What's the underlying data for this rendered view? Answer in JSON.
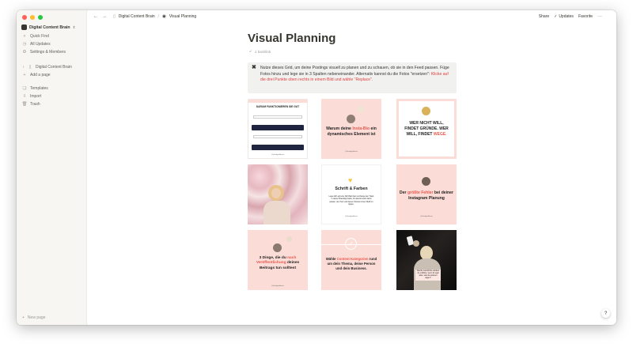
{
  "sidebar": {
    "workspace": "Digital Content Brain",
    "nav": [
      {
        "label": "Quick Find",
        "icon": "search-icon"
      },
      {
        "label": "All Updates",
        "icon": "clock-icon"
      },
      {
        "label": "Settings & Members",
        "icon": "gear-icon"
      }
    ],
    "pages": [
      {
        "label": "Digital Content Brain",
        "icon": "page-icon"
      },
      {
        "label": "Add a page",
        "icon": "plus-icon"
      }
    ],
    "tools": [
      {
        "label": "Templates",
        "icon": "templates-icon"
      },
      {
        "label": "Import",
        "icon": "import-icon"
      },
      {
        "label": "Trash",
        "icon": "trash-icon"
      }
    ],
    "new_page": "New page"
  },
  "topbar": {
    "breadcrumbs": [
      "Digital Content Brain",
      "Visual Planning"
    ],
    "share": "Share",
    "updates": "Updates",
    "favorite": "Favorite",
    "more": "···"
  },
  "page": {
    "title": "Visual Planning",
    "backlink": "1 backlink",
    "callout_text": "Nutze dieses Grid, um deine Postings visuell zu planen und zu schauen, ob sie in den Feed passen. Füge Fotos hinzu und lege sie in 3 Spalten nebeneinander. Alternativ kannst du die Fotos \"ersetzen\": ",
    "callout_link": "Klicke auf die drei Punkte oben rechts in einem Bild und wähle \"Replace\"."
  },
  "tiles": {
    "t1": {
      "title": "DARUM FUNKTIONIEREN SIE GUT",
      "handle": "@thedigitalbrain"
    },
    "t2": {
      "pre": "Warum deine ",
      "accent": "Insta-Bio",
      "post": " ein dynamisches Element ist",
      "handle": "@thedigitalbrain"
    },
    "t3": {
      "pre": "WER NICHT WILL, FINDET GRÜNDE. WER WILL, FINDET ",
      "accent": "WEGE."
    },
    "t5": {
      "title": "Schrift & Farben",
      "body": "Lege dich auf eine Schriftart fest und fange den Track in deiner Branding Farbe. Du kannst auch damit spielen, den Text und deinen Stories immer Weiß zu tippen.",
      "handle": "@thedigitalbrain"
    },
    "t6": {
      "pre": "Der ",
      "accent": "größte Fehler",
      "post": " bei deiner Instagram Planung",
      "handle": "@thedigitalbrain"
    },
    "t7": {
      "pre": "3 Dinge, die du ",
      "accent": "nach Veröffentlichung",
      "post": " deines Beitrags tun solltest",
      "handle": "@thedigitalbrain"
    },
    "t8": {
      "pre": "Wähle ",
      "accent": "Content Kategorien",
      "post": " rund um dein Thema, deine Person und dein Business."
    },
    "t9": {
      "caption": "Welche Geschichte würdest du erzählen, wenn dir egal wäre, was die anderen sagen?"
    }
  },
  "help": "?",
  "colors": {
    "sidebar_bg": "#f7f6f3",
    "accent_red": "#e03e3e",
    "tile_pink": "#fcdcd6"
  }
}
